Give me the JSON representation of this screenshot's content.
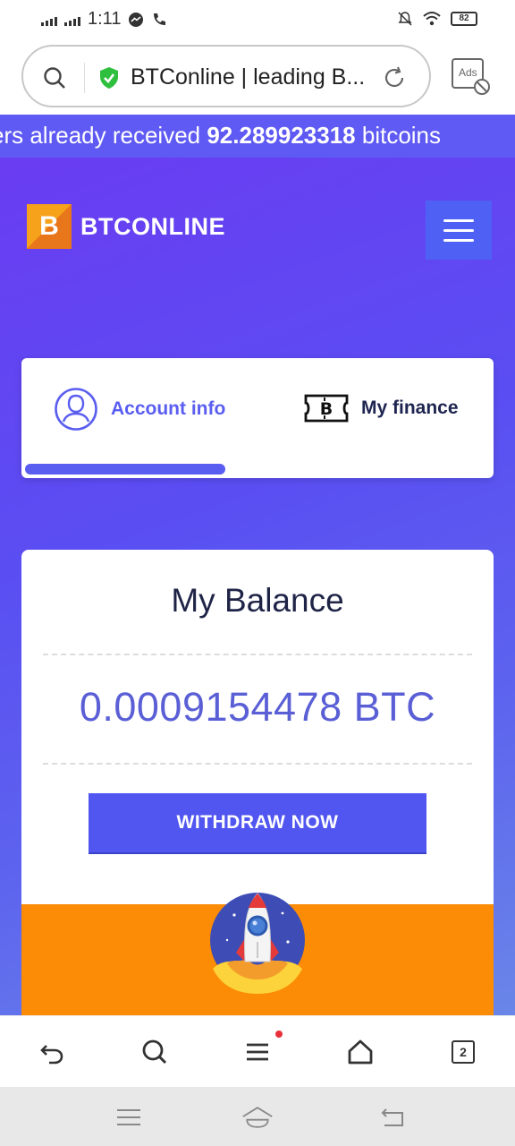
{
  "status_bar": {
    "time": "1:11",
    "battery": "82"
  },
  "browser": {
    "url_text": "BTConline | leading B...",
    "ads_label": "Ads",
    "tabs_count": "2"
  },
  "ticker": {
    "prefix": "ers already received ",
    "amount": "92.289923318",
    "suffix": " bitcoins"
  },
  "site": {
    "logo_letter": "B",
    "logo_text": "BTCONLINE",
    "tabs": [
      {
        "label": "Account info",
        "icon": "user-circle-icon",
        "active": true
      },
      {
        "label": "My finance",
        "icon": "bitcoin-ticket-icon",
        "active": false
      }
    ],
    "balance": {
      "title": "My Balance",
      "value": "0.0009154478 BTC",
      "withdraw_label": "WITHDRAW NOW"
    }
  },
  "colors": {
    "accent": "#5a5ef0",
    "ticker_bg": "#5f5af3",
    "promo_orange": "#fc8c05",
    "logo_orange": "#f7a21b"
  }
}
